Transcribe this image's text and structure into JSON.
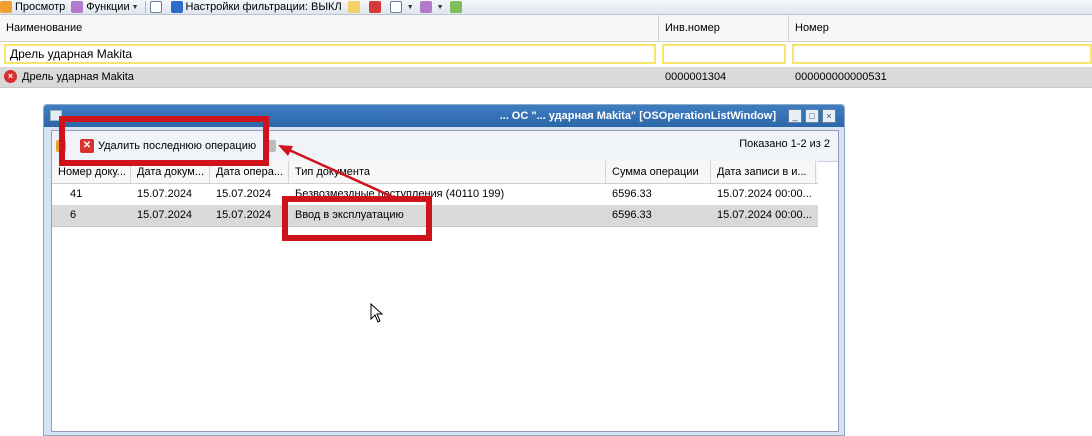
{
  "toolbar": {
    "view_label": "Просмотр",
    "functions_label": "Функции",
    "filter_label": "Настройки фильтрации: ВЫКЛ"
  },
  "grid": {
    "columns": [
      "Наименование",
      "Инв.номер",
      "Номер"
    ],
    "filter_name_value": "Дрель ударная Makita",
    "row": {
      "name": "Дрель ударная Makita",
      "inv_number": "0000001304",
      "number": "000000000000531"
    }
  },
  "window": {
    "title": "... ОС \"... ударная Makita\" [OSOperationListWindow]",
    "delete_label": "Удалить последнюю операцию",
    "shown_text": "Показано 1-2 из 2",
    "columns": [
      "Номер доку...",
      "Дата докум...",
      "Дата опера...",
      "Тип документа",
      "Сумма операции",
      "Дата записи в и..."
    ],
    "rows": [
      {
        "num": "41",
        "doc_date": "15.07.2024",
        "op_date": "15.07.2024",
        "doc_type": "Безвозмездные поступления (40110 199)",
        "sum": "6596.33",
        "rec_date": "15.07.2024 00:00..."
      },
      {
        "num": "6",
        "doc_date": "15.07.2024",
        "op_date": "15.07.2024",
        "doc_type": "Ввод в эксплуатацию",
        "sum": "6596.33",
        "rec_date": "15.07.2024 00:00..."
      }
    ]
  },
  "colors": {
    "highlight_red": "#d0121b",
    "title_blue": "#2c66a8",
    "filter_yellow": "#f7e46a",
    "selected_row_gray": "#d9d9d9"
  }
}
